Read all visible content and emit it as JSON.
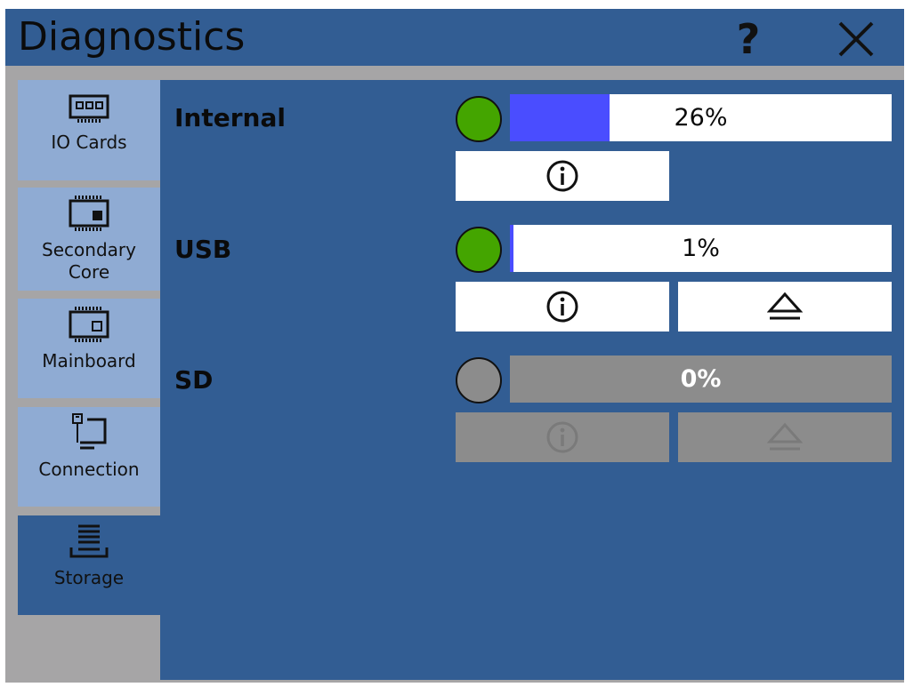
{
  "window": {
    "title": "Diagnostics",
    "help_label": "?",
    "close_icon": "close-icon"
  },
  "sidebar": {
    "items": [
      {
        "label": "IO Cards",
        "icon": "io-card-icon",
        "active": false
      },
      {
        "label": "Secondary Core",
        "icon": "chip-icon",
        "active": false
      },
      {
        "label": "Mainboard",
        "icon": "mainboard-icon",
        "active": false
      },
      {
        "label": "Connection",
        "icon": "connection-icon",
        "active": false
      },
      {
        "label": "Storage",
        "icon": "storage-icon",
        "active": true
      }
    ]
  },
  "storage": [
    {
      "label": "Internal",
      "percent_text": "26%",
      "fill": 0.26,
      "status": "ok",
      "status_color": "#44a500",
      "info": true,
      "eject": false,
      "enabled": true
    },
    {
      "label": "USB",
      "percent_text": "1%",
      "fill": 0.01,
      "status": "ok",
      "status_color": "#44a500",
      "info": true,
      "eject": true,
      "enabled": true
    },
    {
      "label": "SD",
      "percent_text": "0%",
      "fill": 0.0,
      "status": "unavailable",
      "status_color": "#8c8c8c",
      "info": true,
      "eject": true,
      "enabled": false
    }
  ],
  "colors": {
    "background_blue": "#325d93",
    "tab_light": "#8fabd3",
    "fill_blue": "#4a4dff",
    "ok_green": "#44a500",
    "disabled_gray": "#8c8c8c"
  }
}
